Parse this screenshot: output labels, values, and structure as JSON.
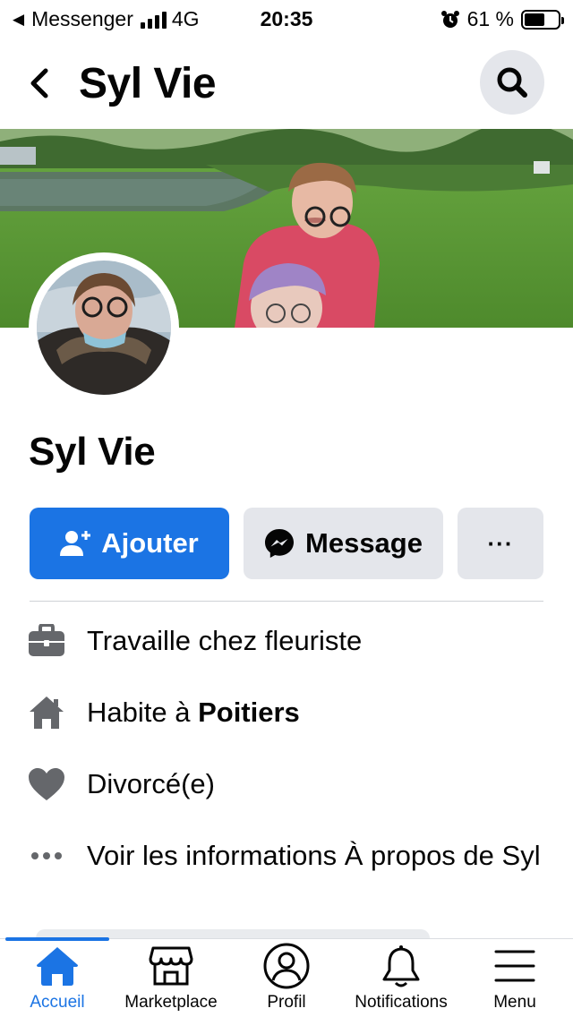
{
  "status_bar": {
    "back_app": "Messenger",
    "network": "4G",
    "time": "20:35",
    "battery_percent": "61 %",
    "battery_level": 0.61
  },
  "header": {
    "title": "Syl Vie",
    "back_icon": "chevron-left-icon",
    "search_icon": "search-icon"
  },
  "profile": {
    "name": "Syl Vie"
  },
  "actions": {
    "add_label": "Ajouter",
    "message_label": "Message",
    "more_label": "···"
  },
  "info": [
    {
      "icon": "briefcase-icon",
      "text": "Travaille chez fleuriste"
    },
    {
      "icon": "home-icon",
      "prefix": "Habite à ",
      "bold": "Poitiers"
    },
    {
      "icon": "heart-icon",
      "text": "Divorcé(e)"
    },
    {
      "icon": "more-icon",
      "text": "Voir les informations À propos de Syl"
    }
  ],
  "bottom_nav": [
    {
      "icon": "home-icon",
      "label": "Accueil",
      "active": true
    },
    {
      "icon": "marketplace-icon",
      "label": "Marketplace",
      "active": false
    },
    {
      "icon": "profile-icon",
      "label": "Profil",
      "active": false
    },
    {
      "icon": "bell-icon",
      "label": "Notifications",
      "active": false
    },
    {
      "icon": "menu-icon",
      "label": "Menu",
      "active": false
    }
  ],
  "colors": {
    "accent": "#1b74e4",
    "secondary_button": "#e4e6eb",
    "icon_gray": "#65676b"
  }
}
